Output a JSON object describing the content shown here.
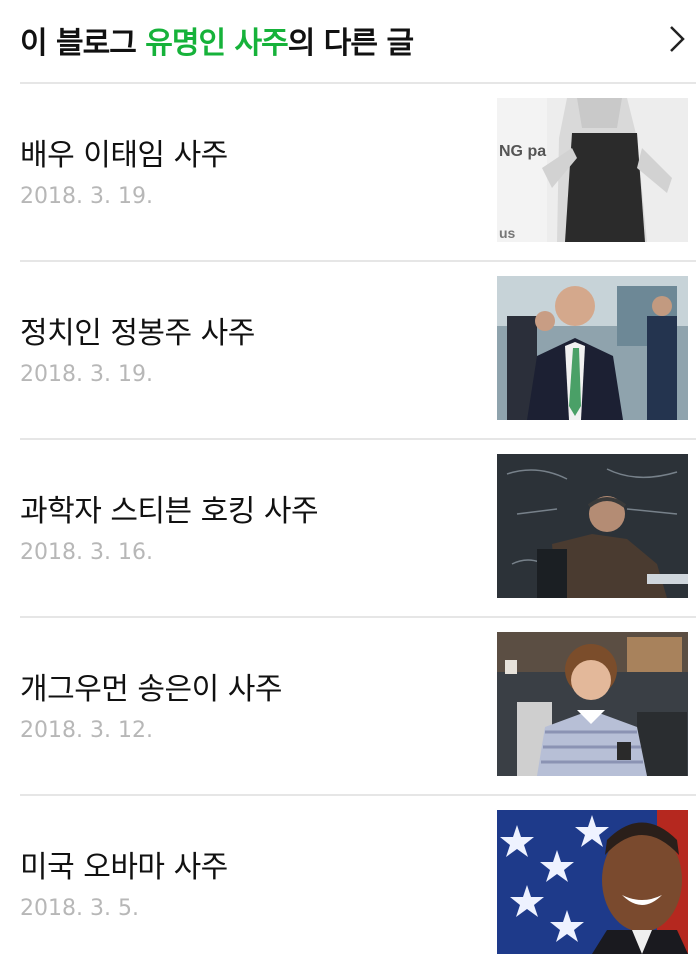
{
  "header": {
    "title_prefix": "이 블로그 ",
    "title_highlight": "유명인 사주",
    "title_suffix": "의 다른 글",
    "highlight_color": "#16b23a",
    "chevron_icon": "chevron-right-icon"
  },
  "posts": [
    {
      "title": "배우 이태임 사주",
      "date": "2018. 3. 19.",
      "thumb_text": "NG pa"
    },
    {
      "title": "정치인 정봉주 사주",
      "date": "2018. 3. 19."
    },
    {
      "title": "과학자 스티븐 호킹 사주",
      "date": "2018. 3. 16."
    },
    {
      "title": "개그우먼 송은이 사주",
      "date": "2018. 3. 12."
    },
    {
      "title": "미국 오바마 사주",
      "date": "2018. 3. 5."
    }
  ]
}
